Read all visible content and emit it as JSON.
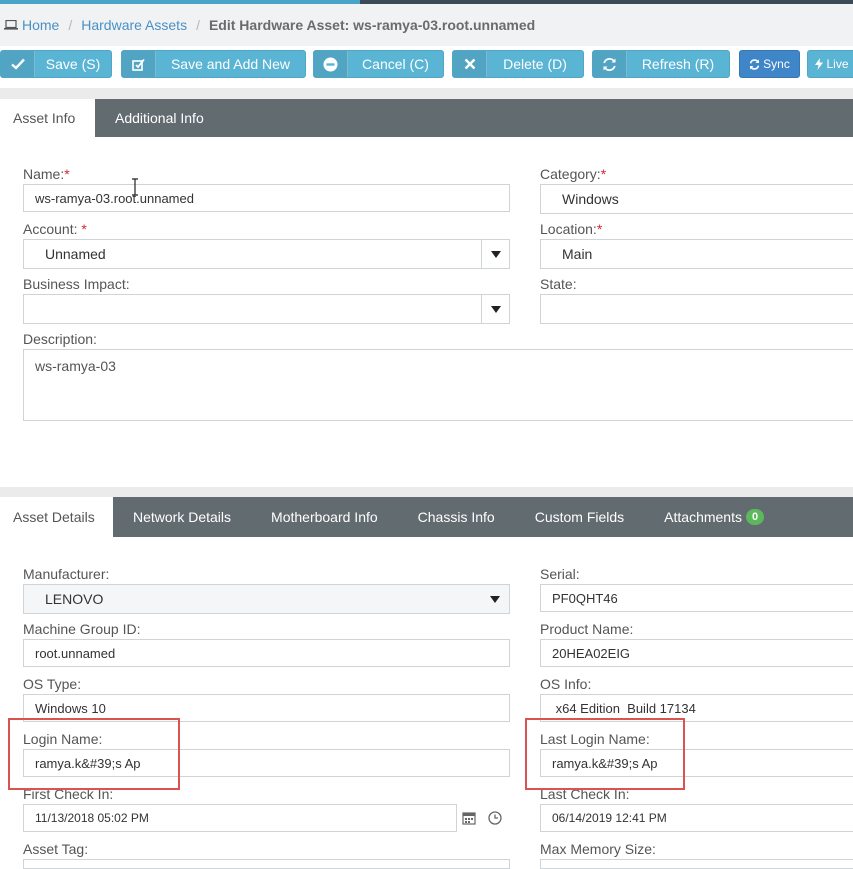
{
  "breadcrumb": {
    "home": "Home",
    "hardware_assets": "Hardware Assets",
    "current": "Edit Hardware Asset: ws-ramya-03.root.unnamed"
  },
  "toolbar": {
    "save": "Save (S)",
    "save_add_new": "Save and Add New",
    "cancel": "Cancel (C)",
    "delete": "Delete (D)",
    "refresh": "Refresh (R)",
    "sync": "Sync",
    "live": "Live"
  },
  "top_tabs": [
    "Asset Info",
    "Additional Info"
  ],
  "asset_info": {
    "name_label": "Name:",
    "name_value": "ws-ramya-03.root.unnamed",
    "account_label": "Account:",
    "account_value": "Unnamed",
    "business_impact_label": "Business Impact:",
    "business_impact_value": "",
    "description_label": "Description:",
    "description_value": "ws-ramya-03",
    "category_label": "Category:",
    "category_value": "Windows",
    "location_label": "Location:",
    "location_value": "Main",
    "state_label": "State:",
    "state_value": ""
  },
  "detail_tabs": [
    "Asset Details",
    "Network Details",
    "Motherboard Info",
    "Chassis Info",
    "Custom Fields",
    "Attachments"
  ],
  "attachments_count": "0",
  "asset_details": {
    "manufacturer_label": "Manufacturer:",
    "manufacturer_value": "LENOVO",
    "machine_group_label": "Machine Group ID:",
    "machine_group_value": "root.unnamed",
    "os_type_label": "OS Type:",
    "os_type_value": "Windows 10",
    "login_name_label": "Login Name:",
    "login_name_value": "ramya.k&#39;s Ap",
    "first_checkin_label": "First Check In:",
    "first_checkin_value": "11/13/2018 05:02 PM",
    "asset_tag_label": "Asset Tag:",
    "serial_label": "Serial:",
    "serial_value": "PF0QHT46",
    "product_name_label": "Product Name:",
    "product_name_value": "20HEA02EIG",
    "os_info_label": "OS Info:",
    "os_info_value": " x64 Edition  Build 17134",
    "last_login_label": "Last Login Name:",
    "last_login_value": "ramya.k&#39;s Ap",
    "last_checkin_label": "Last Check In:",
    "last_checkin_value": "06/14/2019 12:41 PM",
    "max_memory_label": "Max Memory Size:"
  },
  "colors": {
    "accent": "#5ab4d3",
    "sync": "#3f86c9",
    "tabbar": "#626b70",
    "required": "#d9262c",
    "highlight": "#d9534f",
    "badge": "#5cb85c"
  }
}
